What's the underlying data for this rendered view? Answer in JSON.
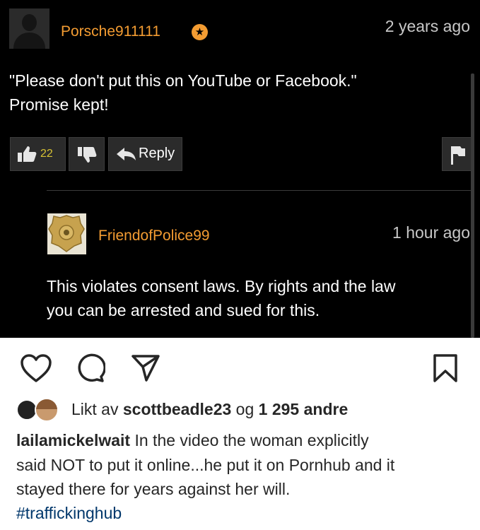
{
  "comment": {
    "username": "Porsche911111",
    "badge_icon": "star-badge-icon",
    "time": "2 years ago",
    "text_line1": "\"Please don't put this on YouTube or Facebook.\"",
    "text_line2": "Promise kept!",
    "like_count": "22",
    "reply_label": "Reply"
  },
  "reply": {
    "username": "FriendofPolice99",
    "time": "1 hour ago",
    "text_line1": "This violates consent laws. By rights and the law",
    "text_line2": "you can be arrested and sued for this."
  },
  "post": {
    "liked_prefix": "Likt av ",
    "liked_user": "scottbeadle23",
    "liked_mid": " og ",
    "liked_count": "1 295 andre",
    "caption_user": "lailamickelwait",
    "caption_line1": " In the video the woman explicitly",
    "caption_line2": "said NOT to put it online...he put it on Pornhub and it",
    "caption_line3": "stayed there for years against her will.",
    "hashtag": "#traffickinghub"
  },
  "colors": {
    "username": "#f39c32",
    "like_count": "#d7c234",
    "hashtag": "#00376b"
  }
}
